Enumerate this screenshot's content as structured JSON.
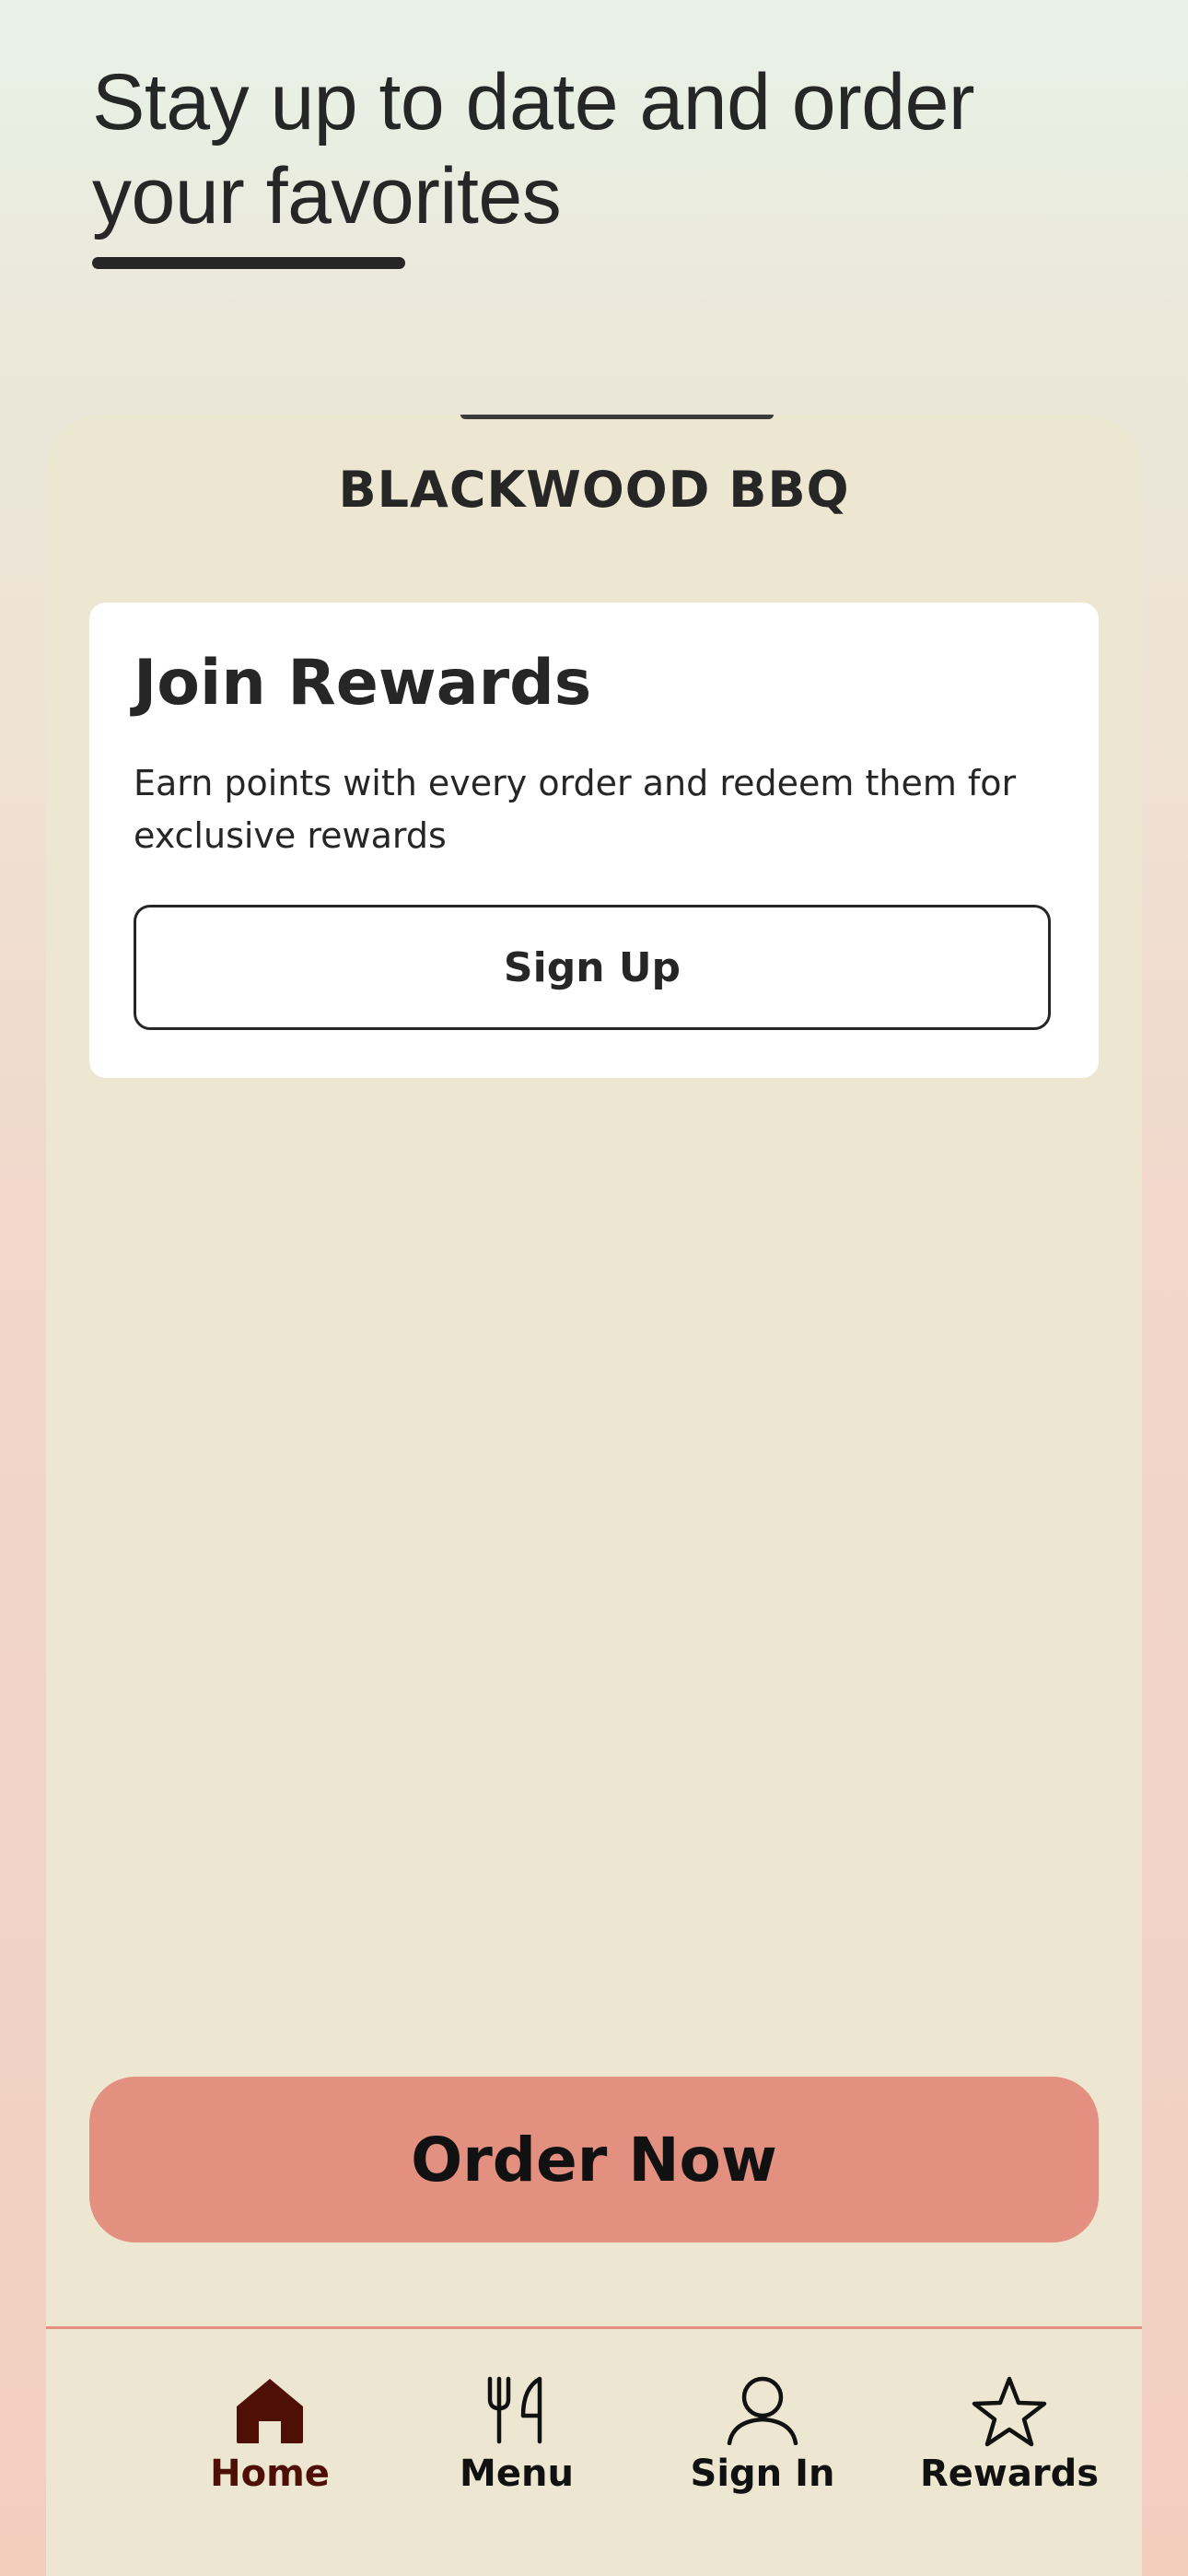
{
  "promo": {
    "headline": "Stay up to date and order your favorites"
  },
  "app": {
    "brand": "BLACKWOOD BBQ",
    "rewards_card": {
      "title": "Join Rewards",
      "description": "Earn points with every order and redeem them for exclusive rewards",
      "signup_label": "Sign Up"
    },
    "order_button_label": "Order Now",
    "tabbar": {
      "items": [
        {
          "label": "Home",
          "icon": "home-icon",
          "active": true
        },
        {
          "label": "Menu",
          "icon": "fork-knife-icon",
          "active": false
        },
        {
          "label": "Sign In",
          "icon": "person-icon",
          "active": false
        },
        {
          "label": "Rewards",
          "icon": "star-icon",
          "active": false
        }
      ]
    }
  },
  "colors": {
    "accent": "#e39080",
    "active_tab": "#4e0f06",
    "surface": "#ede7d2",
    "text": "#262626"
  }
}
